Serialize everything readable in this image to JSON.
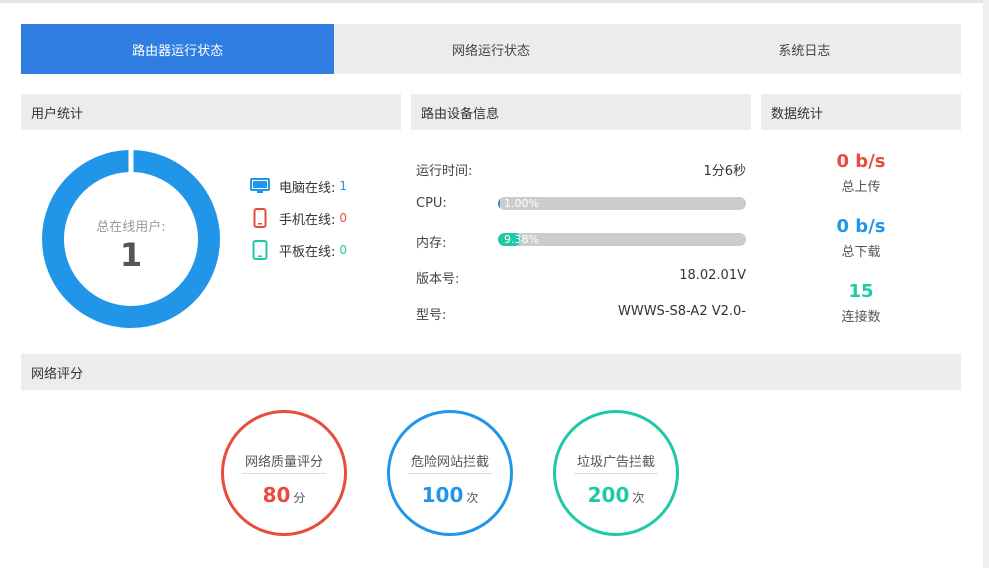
{
  "tabs": [
    {
      "label": "路由器运行状态",
      "active": true
    },
    {
      "label": "网络运行状态",
      "active": false
    },
    {
      "label": "系统日志",
      "active": false
    }
  ],
  "user_stats": {
    "title": "用户统计",
    "online_label": "总在线用户:",
    "online_total": "1",
    "donut_color": "#2196e8",
    "devices": [
      {
        "label": "电脑在线:",
        "count": "1",
        "icon": "monitor-icon",
        "color": "#2196e8"
      },
      {
        "label": "手机在线:",
        "count": "0",
        "icon": "phone-icon",
        "color": "#e84c3d"
      },
      {
        "label": "平板在线:",
        "count": "0",
        "icon": "tablet-icon",
        "color": "#1fc9a5"
      }
    ]
  },
  "device_info": {
    "title": "路由设备信息",
    "uptime_label": "运行时间:",
    "uptime_value": "1分6秒",
    "cpu_label": "CPU:",
    "cpu_text": "1.00%",
    "cpu_percent": 1.0,
    "cpu_color": "#2196e8",
    "mem_label": "内存:",
    "mem_text": "9.38%",
    "mem_percent": 9.38,
    "mem_color": "#1fc9a5",
    "version_label": "版本号:",
    "version_value": "18.02.01V",
    "model_label": "型号:",
    "model_value": "WWWS-S8-A2 V2.0-"
  },
  "data_stats": {
    "title": "数据统计",
    "upload_value": "0 b/s",
    "upload_label": "总上传",
    "upload_color": "#e84c3d",
    "download_value": "0 b/s",
    "download_label": "总下载",
    "download_color": "#2196e8",
    "connections_value": "15",
    "connections_label": "连接数",
    "connections_color": "#1fc9a5"
  },
  "network_score": {
    "title": "网络评分",
    "items": [
      {
        "title": "网络质量评分",
        "value": "80",
        "unit": "分",
        "color": "#e84c3d"
      },
      {
        "title": "危险网站拦截",
        "value": "100",
        "unit": "次",
        "color": "#2196e8"
      },
      {
        "title": "垃圾广告拦截",
        "value": "200",
        "unit": "次",
        "color": "#1fc9a5"
      }
    ]
  }
}
